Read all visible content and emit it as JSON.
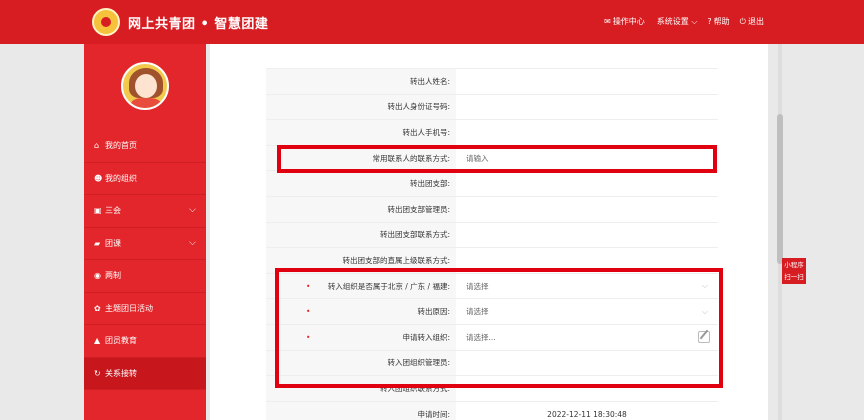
{
  "header": {
    "brand": "网上共青团 • 智慧团建",
    "nav": [
      {
        "icon": "mail-icon",
        "glyph": "✉",
        "label": "操作中心"
      },
      {
        "icon": "settings-dropdown",
        "glyph": "",
        "label": "系统设置 ⌵"
      },
      {
        "icon": "help-icon",
        "glyph": "?",
        "label": "帮助"
      },
      {
        "icon": "power-icon",
        "glyph": "⏻",
        "label": "退出"
      }
    ]
  },
  "sidebar": {
    "items": [
      {
        "icon": "home-icon",
        "glyph": "⌂",
        "label": "我的首页"
      },
      {
        "icon": "users-icon",
        "glyph": "☻",
        "label": "我的组织"
      },
      {
        "icon": "edit-icon",
        "glyph": "▣",
        "label": "三会",
        "chevron": "⌵"
      },
      {
        "icon": "folder-icon",
        "glyph": "▰",
        "label": "团课",
        "chevron": "⌵"
      },
      {
        "icon": "gear-icon",
        "glyph": "◉",
        "label": "两制"
      },
      {
        "icon": "star-icon",
        "glyph": "✿",
        "label": "主题团日活动"
      },
      {
        "icon": "graduation-icon",
        "glyph": "▲",
        "label": "团员教育"
      },
      {
        "icon": "refresh-icon",
        "glyph": "↻",
        "label": "关系接转"
      }
    ]
  },
  "form": {
    "rows": [
      {
        "label": "转出人姓名:",
        "value": ""
      },
      {
        "label": "转出人身份证号码:",
        "value": ""
      },
      {
        "label": "转出人手机号:",
        "value": ""
      },
      {
        "label": "常用联系人的联系方式:",
        "value": "请输入"
      },
      {
        "label": "转出团支部:",
        "value": ""
      },
      {
        "label": "转出团支部管理员:",
        "value": ""
      },
      {
        "label": "转出团支部联系方式:",
        "value": ""
      },
      {
        "label": "转出团支部的直属上级联系方式:",
        "value": ""
      },
      {
        "label": "转入组织是否属于北京 / 广东 / 福建:",
        "value": "请选择",
        "required": "•",
        "arrow": "⌵"
      },
      {
        "label": "转出原因:",
        "value": "请选择",
        "required": "•",
        "arrow": "⌵"
      },
      {
        "label": "申请转入组织:",
        "value": "请选择...",
        "required": "•",
        "edit": true
      },
      {
        "label": "转入团组织管理员:",
        "value": ""
      },
      {
        "label": "转入团组织联系方式:",
        "value": ""
      },
      {
        "label": "申请时间:",
        "value": "2022-12-11 18:30:48",
        "center": true
      }
    ]
  },
  "mini_program": {
    "line1": "小程序",
    "line2": "扫一扫"
  },
  "colors": {
    "brand_red": "#d71c22",
    "highlight_red": "#e10010"
  }
}
